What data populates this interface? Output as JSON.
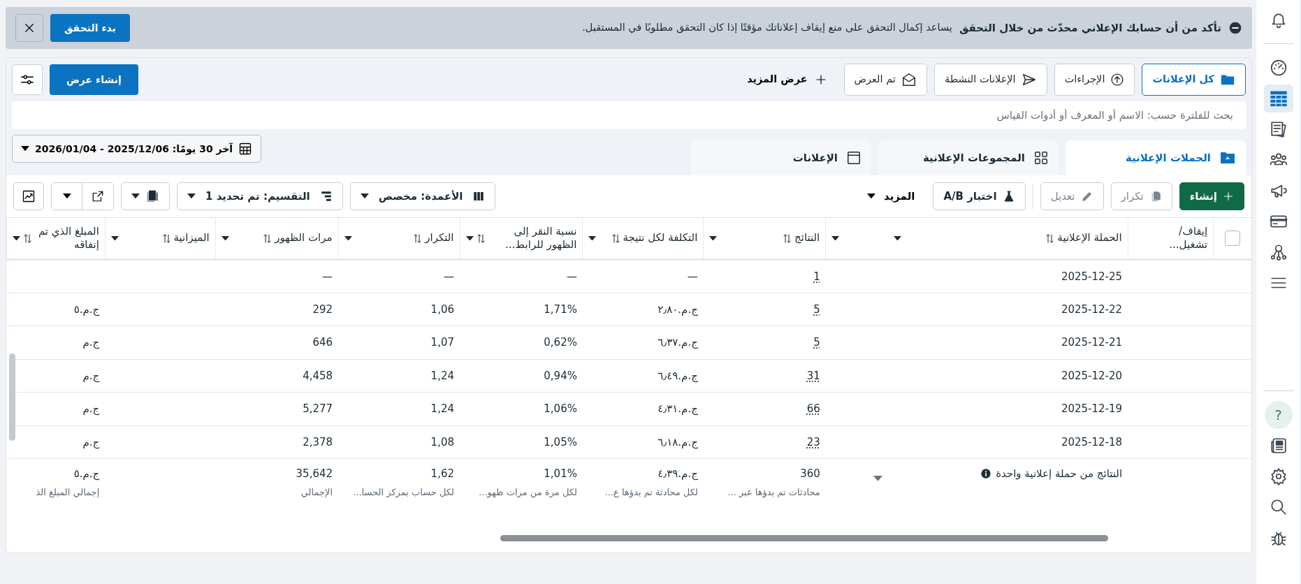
{
  "banner": {
    "title": "تأكد من أن حسابك الإعلاني محدّث من خلال التحقق",
    "message": "يساعد إكمال التحقق على منع إيقاف إعلاناتك مؤقتًا إذا كان التحقق مطلوبًا في المستقبل.",
    "action": "بدء التحقق"
  },
  "views": {
    "tabs": [
      {
        "label": "كل الإعلانات",
        "selected": true
      },
      {
        "label": "الإجراءات",
        "selected": false
      },
      {
        "label": "الإعلانات النشطة",
        "selected": false
      },
      {
        "label": "تم العرض",
        "selected": false
      }
    ],
    "more": "عرض المزيد",
    "create": "إنشاء عرض"
  },
  "search": {
    "placeholder": "بحث للفلترة حسب: الاسم أو المعرف أو أدوات القياس"
  },
  "level_tabs": [
    {
      "label": "الحملات الإعلانية",
      "selected": true
    },
    {
      "label": "المجموعات الإعلانية",
      "selected": false
    },
    {
      "label": "الإعلانات",
      "selected": false
    }
  ],
  "date_range": "آخر 30 يومًا: 2025/12/06 - 2026/01/04",
  "toolbar": {
    "actions": [
      {
        "label": "إنشاء",
        "kind": "create",
        "disabled": false
      },
      {
        "label": "تكرار",
        "kind": "duplicate",
        "disabled": true
      },
      {
        "label": "تعديل",
        "kind": "edit",
        "disabled": true
      },
      {
        "label": "اختبار A/B",
        "kind": "test",
        "disabled": false
      }
    ],
    "more": "المزيد",
    "columns": "الأعمدة: مخصص",
    "breakdown": "التقسيم: تم تحديد 1"
  },
  "table": {
    "select_all": {
      "checked": false
    },
    "columns": [
      {
        "label": "إيقاف/ تشغيل...",
        "kind": "toggle"
      },
      {
        "label": "الحملة الإعلانية",
        "kind": "name"
      },
      {
        "label": "النتائج",
        "kind": "results"
      },
      {
        "label": "التكلفة لكل نتيجة",
        "kind": "metric"
      },
      {
        "label": "نسبة النقر إلى الظهور للرابط...",
        "kind": "metric"
      },
      {
        "label": "التكرار",
        "kind": "metric"
      },
      {
        "label": "مرات الظهور",
        "kind": "metric"
      },
      {
        "label": "الميزانية",
        "kind": "metric"
      },
      {
        "label": "المبلغ الذي تم إنفاقه",
        "kind": "metric"
      }
    ],
    "rows": [
      {
        "cells": [
          null,
          "2025-12-25",
          "1",
          "—",
          "—",
          "—",
          "—",
          null,
          null
        ]
      },
      {
        "cells": [
          null,
          "2025-12-22",
          "5",
          "ج.م.٢٫٨٠",
          "1,71%",
          "1,06",
          "292",
          null,
          "ج.م.٥"
        ]
      },
      {
        "cells": [
          null,
          "2025-12-21",
          "5",
          "ج.م.٦٫٣٧",
          "0,62%",
          "1,07",
          "646",
          null,
          "ج.م"
        ]
      },
      {
        "cells": [
          null,
          "2025-12-20",
          "31",
          "ج.م.٦٫٤٩",
          "0,94%",
          "1,24",
          "4,458",
          null,
          "ج.م"
        ]
      },
      {
        "cells": [
          null,
          "2025-12-19",
          "66",
          "ج.م.٤٫٣١",
          "1,06%",
          "1,24",
          "5,277",
          null,
          "ج.م"
        ]
      },
      {
        "cells": [
          null,
          "2025-12-18",
          "23",
          "ج.م.٦٫١٨",
          "1,05%",
          "1,08",
          "2,378",
          null,
          "ج.م"
        ]
      }
    ],
    "totals": [
      {
        "cells": [
          null,
          "النتائج من حملة إعلانية واحدة",
          "360",
          "ج.م.٤٫٣٩",
          "1,01%",
          "1,62",
          "35,642",
          null,
          "ج.م.٥"
        ]
      },
      {
        "cells": [
          null,
          null,
          "محادثات تم بدؤها عبر ...",
          "لكل محادثة تم بدؤها ع...",
          "لكل مرة من مرات ظهو...",
          "لكل حساب بمركز الحسا...",
          "الإجمالي",
          null,
          "إجمالي المبلغ الذ"
        ]
      }
    ]
  },
  "sidebar": {
    "groups": [
      {
        "items": [
          {
            "selected": false
          }
        ]
      },
      {
        "items": [
          {
            "selected": false
          },
          {
            "selected": true
          },
          {
            "selected": false
          },
          {
            "selected": false
          },
          {
            "selected": false
          },
          {
            "selected": false
          },
          {
            "selected": false
          },
          {
            "selected": false
          }
        ]
      },
      {
        "items": [
          {
            "label": "?"
          },
          {
            "selected": false
          },
          {
            "selected": false
          },
          {
            "selected": false
          },
          {
            "selected": false
          }
        ]
      }
    ]
  }
}
